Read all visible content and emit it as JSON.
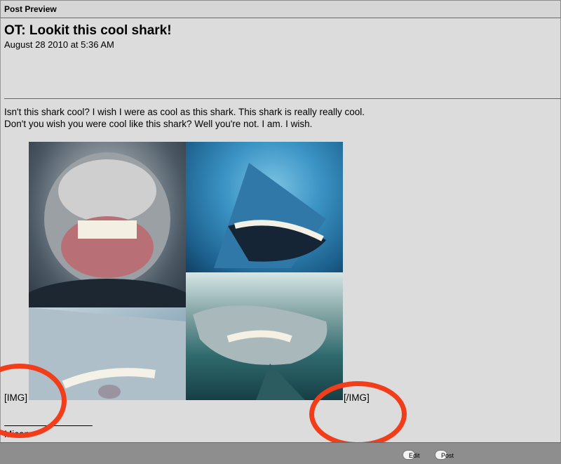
{
  "window": {
    "title": "Post Preview"
  },
  "post": {
    "title": "OT: Lookit this cool shark!",
    "date": "August 28 2010 at 5:36 AM",
    "body_lines": [
      "Isn't this shark cool? I wish I were as cool as this shark. This shark is really really cool.",
      "Don't you wish you were cool like this shark? Well you're not. I am. I wish."
    ],
    "img_open_tag": "[IMG]",
    "img_close_tag": "[/IMG]",
    "signature": "Mican"
  },
  "footer": {
    "edit_label": "Edit",
    "post_label": "Post"
  },
  "colors": {
    "annotation_circle": "#f23d1a"
  }
}
